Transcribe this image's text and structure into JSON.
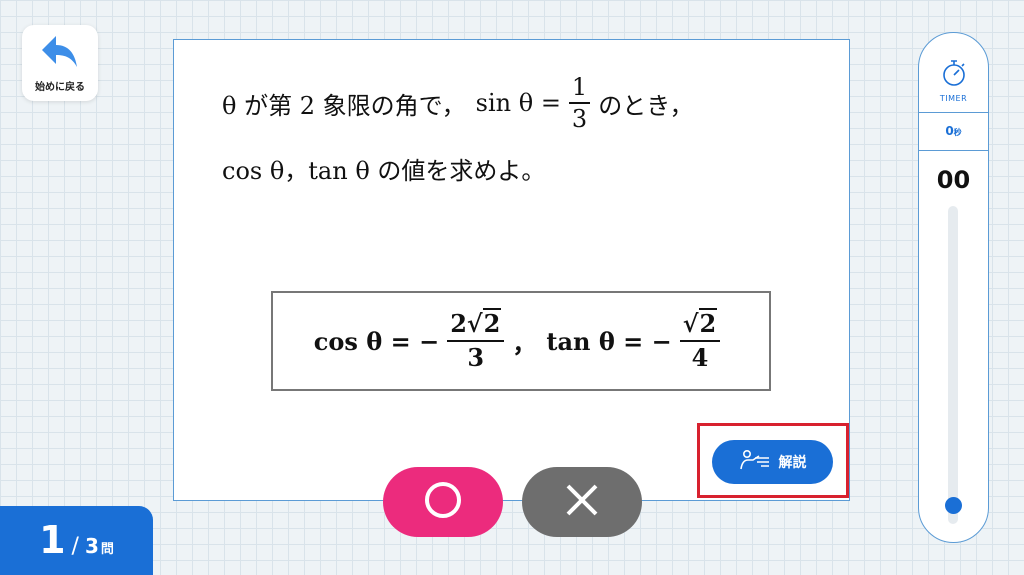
{
  "nav": {
    "back_label": "始めに戻る"
  },
  "question": {
    "line1_pre": "θ が第 2 象限の角で，",
    "line1_sin": "sin θ =",
    "line1_num": "1",
    "line1_den": "3",
    "line1_post": "のとき，",
    "line2": "cos θ，tan θ  の値を求めよ。"
  },
  "answer": {
    "cos_part": "cos θ = −",
    "cos_num_coef": "2",
    "cos_num_rad": "2",
    "cos_den": "3",
    "sep": "，",
    "tan_part": "tan θ = −",
    "tan_num_rad": "2",
    "tan_den": "4"
  },
  "explain_button": {
    "label": "解説"
  },
  "counter": {
    "current": "1",
    "separator": "/",
    "total": "3",
    "unit": "問"
  },
  "timer": {
    "label": "TIMER",
    "seconds_value": "0",
    "seconds_unit": "秒",
    "display": "00",
    "progress": 0
  },
  "colors": {
    "accent": "#1a6fd6",
    "correct": "#ec2b7d",
    "wrong": "#6e6e6e",
    "highlight": "#d8212f"
  }
}
